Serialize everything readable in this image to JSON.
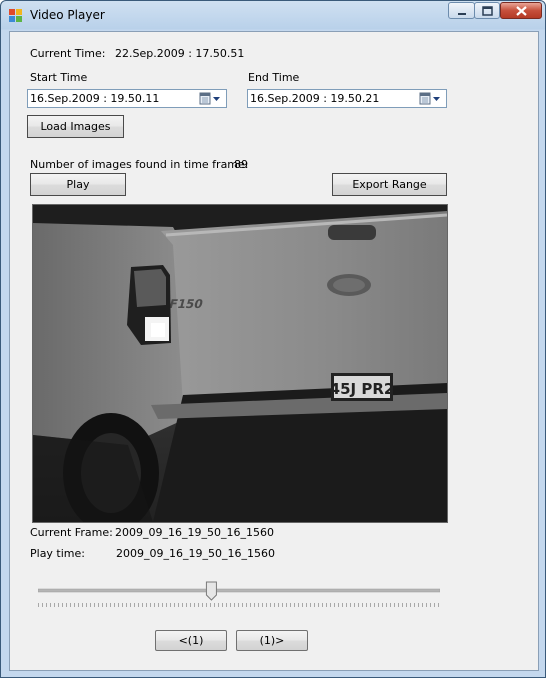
{
  "window": {
    "title": "Video Player"
  },
  "current_time": {
    "label": "Current Time:",
    "value": "22.Sep.2009 : 17.50.51"
  },
  "start_time": {
    "label": "Start Time",
    "value": "16.Sep.2009 : 19.50.11"
  },
  "end_time": {
    "label": "End Time",
    "value": "16.Sep.2009 : 19.50.21"
  },
  "load_button": "Load Images",
  "images_found": {
    "label": "Number of images found in time frame:",
    "value": "89"
  },
  "play_button": "Play",
  "export_button": "Export Range",
  "viewer": {
    "plate_text": "45J PR2"
  },
  "current_frame": {
    "label": "Current Frame:",
    "value": "2009_09_16_19_50_16_1560"
  },
  "play_time": {
    "label": "Play time:",
    "value": "2009_09_16_19_50_16_1560"
  },
  "slider": {
    "position_fraction": 0.43
  },
  "nav": {
    "prev_label": "<(1)",
    "next_label": "(1)>"
  }
}
